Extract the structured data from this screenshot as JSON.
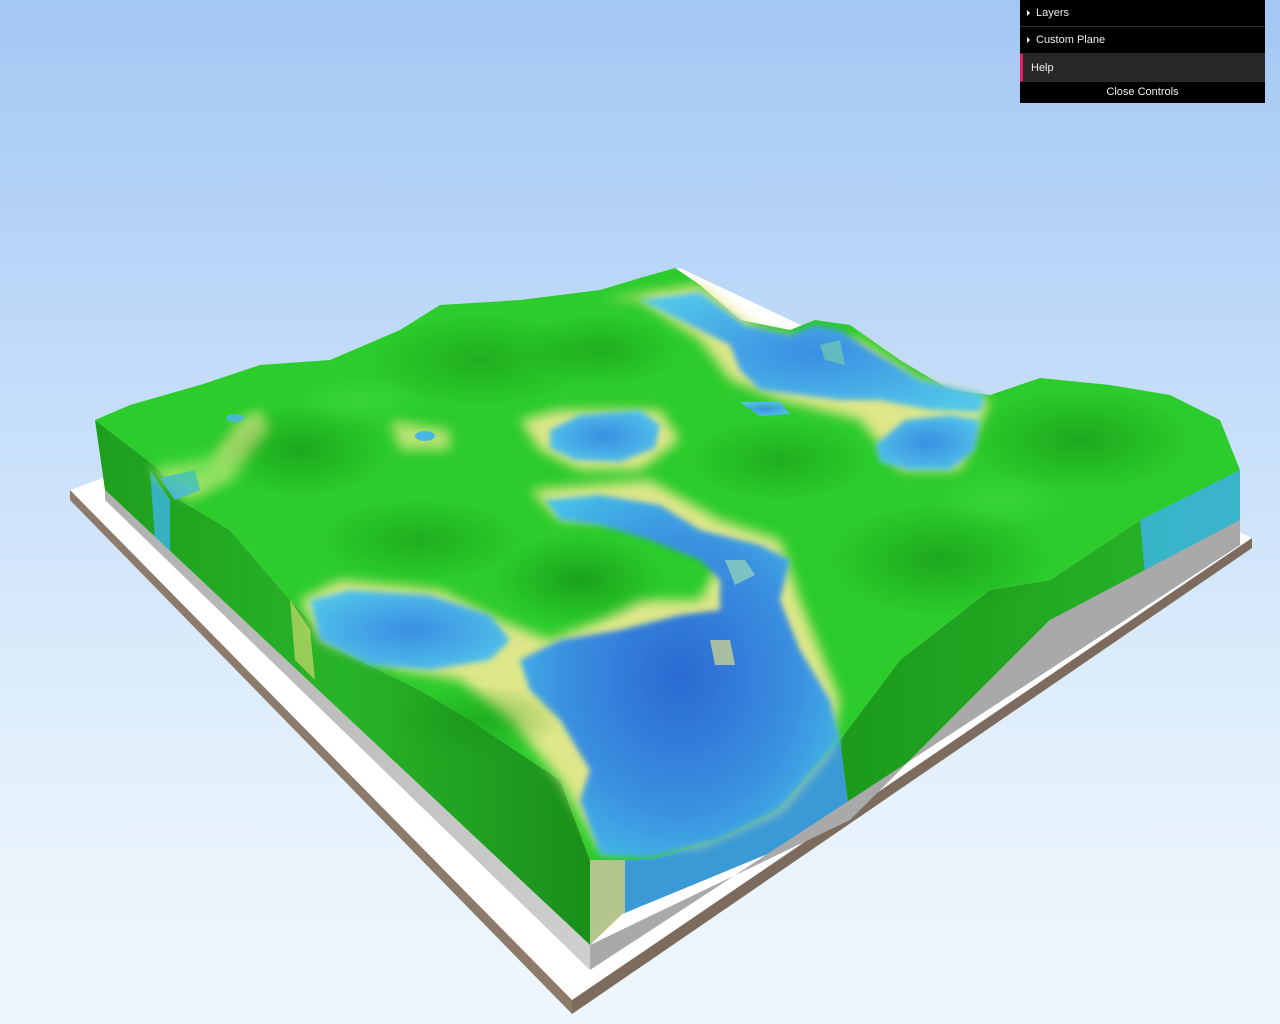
{
  "gui": {
    "folders": [
      {
        "label": "Layers",
        "collapsed": true
      },
      {
        "label": "Custom Plane",
        "collapsed": true
      }
    ],
    "help_label": "Help",
    "close_label": "Close Controls",
    "accent_color": "#e61d5f"
  },
  "scene": {
    "colors": {
      "sky_top": "#a3c7f3",
      "sky_bottom": "#eff7fd",
      "base_top": "#ffffff",
      "base_side": "#8c7b6b",
      "grass": "#22c822",
      "grass_dark": "#149614",
      "sand": "#f0eb96",
      "water": "#3cb4e6",
      "water_deep": "#2a6ad2"
    }
  }
}
